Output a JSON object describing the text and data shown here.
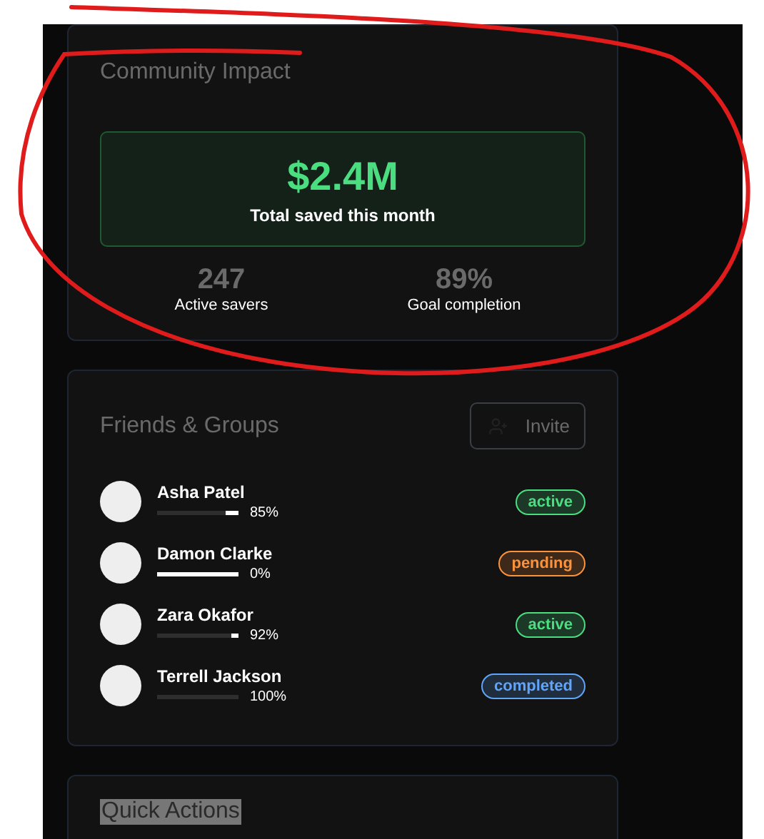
{
  "impact": {
    "title": "Community Impact",
    "total": "$2.4M",
    "total_label": "Total saved this month",
    "stats": [
      {
        "value": "247",
        "label": "Active savers"
      },
      {
        "value": "89%",
        "label": "Goal completion"
      }
    ]
  },
  "friends": {
    "title": "Friends & Groups",
    "invite": "Invite",
    "members": [
      {
        "name": "Asha Patel",
        "level": 0.85,
        "percent": "85%",
        "status": "active",
        "color": "#4ade80"
      },
      {
        "name": "Damon Clarke",
        "level": 0,
        "percent": "0%",
        "status": "pending",
        "color": "#fb923c"
      },
      {
        "name": "Zara Okafor",
        "level": 0.92,
        "percent": "92%",
        "status": "active",
        "color": "#4ade80"
      },
      {
        "name": "Terrell Jackson",
        "level": 1,
        "percent": "100%",
        "status": "completed",
        "color": "#60a5fa"
      }
    ]
  },
  "quick_actions": {
    "title": "Quick Actions"
  }
}
